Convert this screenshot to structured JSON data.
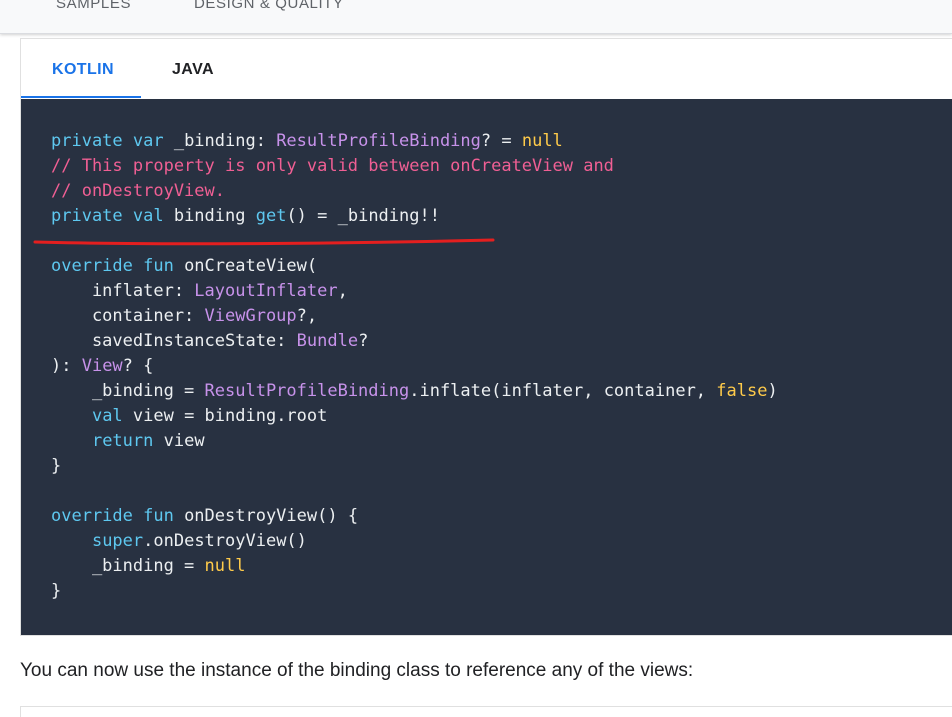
{
  "topnav": {
    "items": [
      "SAMPLES",
      "DESIGN & QUALITY"
    ]
  },
  "tabs": [
    {
      "label": "KOTLIN",
      "active": true
    },
    {
      "label": "JAVA",
      "active": false
    }
  ],
  "colors": {
    "accent": "#1a73e8",
    "code_background": "#283141",
    "keyword": "#5ec8f0",
    "comment": "#f05f94",
    "type": "#c792ea",
    "literal": "#ffcb4a",
    "annotation_underline": "#e41f1f"
  },
  "code": {
    "language": "kotlin",
    "lines": [
      [
        {
          "t": "kw",
          "v": "private var"
        },
        {
          "t": "p",
          "v": " _binding: "
        },
        {
          "t": "ty",
          "v": "ResultProfileBinding"
        },
        {
          "t": "p",
          "v": "? = "
        },
        {
          "t": "lit",
          "v": "null"
        }
      ],
      [
        {
          "t": "cm",
          "v": "// This property is only valid between onCreateView and"
        }
      ],
      [
        {
          "t": "cm",
          "v": "// onDestroyView."
        }
      ],
      [
        {
          "t": "kw",
          "v": "private val"
        },
        {
          "t": "p",
          "v": " binding "
        },
        {
          "t": "kw",
          "v": "get"
        },
        {
          "t": "p",
          "v": "() = _binding!!"
        }
      ],
      [],
      [
        {
          "t": "kw",
          "v": "override fun"
        },
        {
          "t": "p",
          "v": " onCreateView("
        }
      ],
      [
        {
          "t": "p",
          "v": "    inflater: "
        },
        {
          "t": "ty",
          "v": "LayoutInflater"
        },
        {
          "t": "p",
          "v": ","
        }
      ],
      [
        {
          "t": "p",
          "v": "    container: "
        },
        {
          "t": "ty",
          "v": "ViewGroup"
        },
        {
          "t": "p",
          "v": "?,"
        }
      ],
      [
        {
          "t": "p",
          "v": "    savedInstanceState: "
        },
        {
          "t": "ty",
          "v": "Bundle"
        },
        {
          "t": "p",
          "v": "?"
        }
      ],
      [
        {
          "t": "p",
          "v": "): "
        },
        {
          "t": "ty",
          "v": "View"
        },
        {
          "t": "p",
          "v": "? {"
        }
      ],
      [
        {
          "t": "p",
          "v": "    _binding = "
        },
        {
          "t": "ty",
          "v": "ResultProfileBinding"
        },
        {
          "t": "p",
          "v": ".inflate(inflater, container, "
        },
        {
          "t": "lit",
          "v": "false"
        },
        {
          "t": "p",
          "v": ")"
        }
      ],
      [
        {
          "t": "p",
          "v": "    "
        },
        {
          "t": "kw",
          "v": "val"
        },
        {
          "t": "p",
          "v": " view = binding.root"
        }
      ],
      [
        {
          "t": "p",
          "v": "    "
        },
        {
          "t": "kw",
          "v": "return"
        },
        {
          "t": "p",
          "v": " view"
        }
      ],
      [
        {
          "t": "p",
          "v": "}"
        }
      ],
      [],
      [
        {
          "t": "kw",
          "v": "override fun"
        },
        {
          "t": "p",
          "v": " onDestroyView() {"
        }
      ],
      [
        {
          "t": "p",
          "v": "    "
        },
        {
          "t": "kw",
          "v": "super"
        },
        {
          "t": "p",
          "v": ".onDestroyView()"
        }
      ],
      [
        {
          "t": "p",
          "v": "    _binding = "
        },
        {
          "t": "lit",
          "v": "null"
        }
      ],
      [
        {
          "t": "p",
          "v": "}"
        }
      ]
    ]
  },
  "prose": {
    "text": "You can now use the instance of the binding class to reference any of the views:"
  }
}
